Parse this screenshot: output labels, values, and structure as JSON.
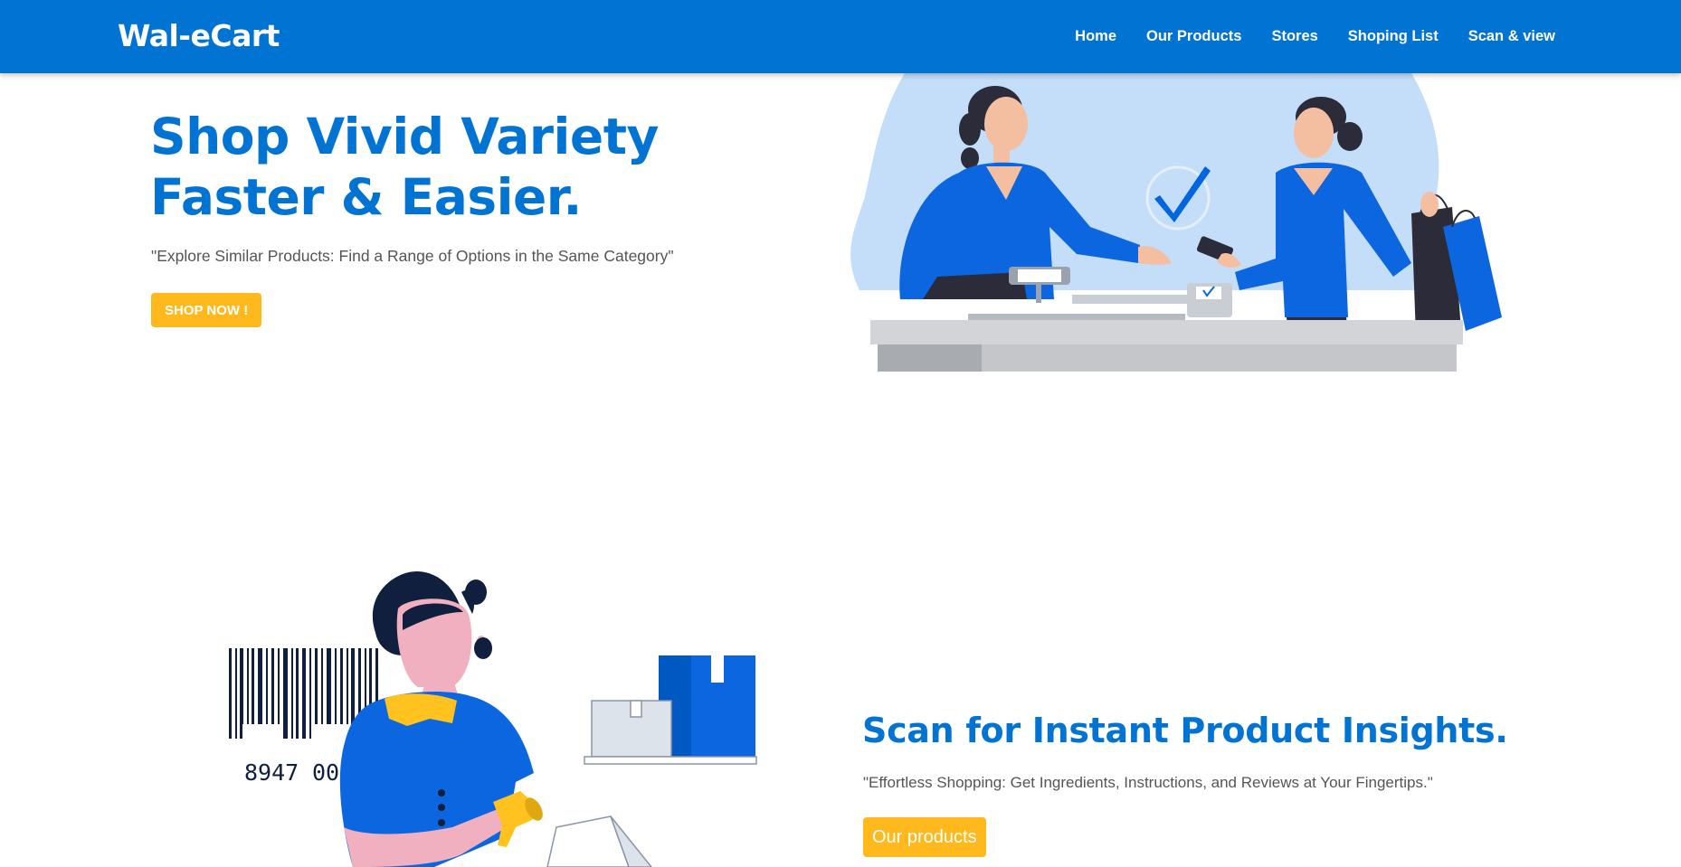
{
  "navbar": {
    "brand": "Wal-eCart",
    "links": [
      "Home",
      "Our Products",
      "Stores",
      "Shoping List",
      "Scan & view"
    ]
  },
  "hero": {
    "title": "Shop Vivid Variety Faster & Easier.",
    "subtitle": "\"Explore Similar Products: Find a Range of Options in the Same Category\"",
    "button": "SHOP NOW !"
  },
  "scan": {
    "title": "Scan for Instant Product Insights.",
    "subtitle": "\"Effortless Shopping: Get Ingredients, Instructions, and Reviews at Your Fingertips.\"",
    "button": "Our products",
    "barcode_left": "8947",
    "barcode_right": "0007"
  },
  "colors": {
    "primary": "#0173d2",
    "accent": "#ffb91c",
    "text_muted": "#555555"
  },
  "icons": {
    "checkout_check": "check-circle-icon"
  }
}
